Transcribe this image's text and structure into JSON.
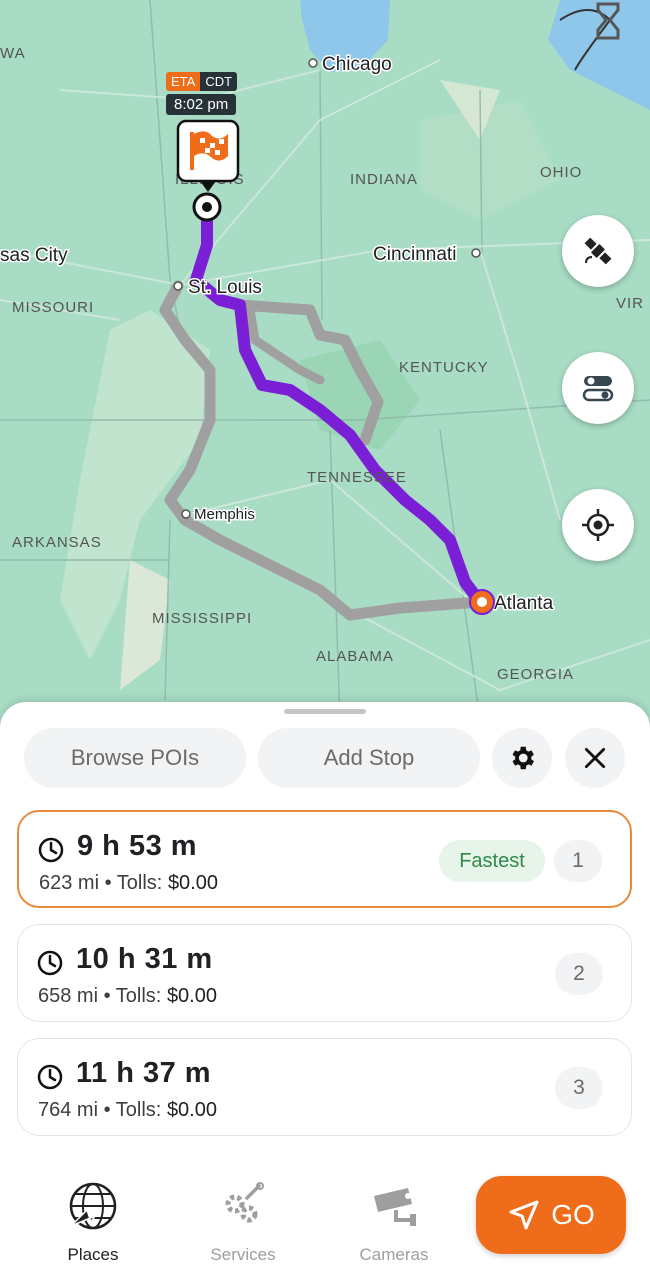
{
  "map": {
    "state_labels": [
      "INDIANA",
      "OHIO",
      "MISSOURI",
      "KENTUCKY",
      "TENNESSEE",
      "ARKANSAS",
      "MISSISSIPPI",
      "ALABAMA",
      "GEORGIA",
      "ILLINOIS",
      "WA",
      "VIR"
    ],
    "city_labels": [
      "Chicago",
      "Cincinnati",
      "St. Louis",
      "Memphis",
      "Atlanta",
      "sas City"
    ],
    "eta": {
      "tag": "ETA",
      "timezone": "CDT",
      "time": "8:02 pm"
    },
    "colors": {
      "active_route": "#7a1fd6",
      "alt_route": "#a0a0a0",
      "water": "#8ec7ea",
      "land": "#a8dcc4",
      "brand": "#ef6c1a"
    }
  },
  "map_buttons": [
    {
      "name": "satellite",
      "icon": "satellite-icon"
    },
    {
      "name": "layers-toggle",
      "icon": "toggle-icon"
    },
    {
      "name": "recenter",
      "icon": "crosshair-icon"
    }
  ],
  "sheet": {
    "browse_pois_label": "Browse POIs",
    "add_stop_label": "Add Stop",
    "settings_icon": "gear-icon",
    "close_icon": "close-icon"
  },
  "routes": [
    {
      "duration": "9 h 53 m",
      "distance": "623 mi",
      "tolls_label": "Tolls:",
      "tolls": "$0.00",
      "badge": "Fastest",
      "index": "1",
      "selected": true
    },
    {
      "duration": "10 h 31 m",
      "distance": "658 mi",
      "tolls_label": "Tolls:",
      "tolls": "$0.00",
      "index": "2",
      "selected": false
    },
    {
      "duration": "11 h 37 m",
      "distance": "764 mi",
      "tolls_label": "Tolls:",
      "tolls": "$0.00",
      "index": "3",
      "selected": false
    }
  ],
  "nav": {
    "places_label": "Places",
    "services_label": "Services",
    "cameras_label": "Cameras",
    "go_label": "GO"
  }
}
